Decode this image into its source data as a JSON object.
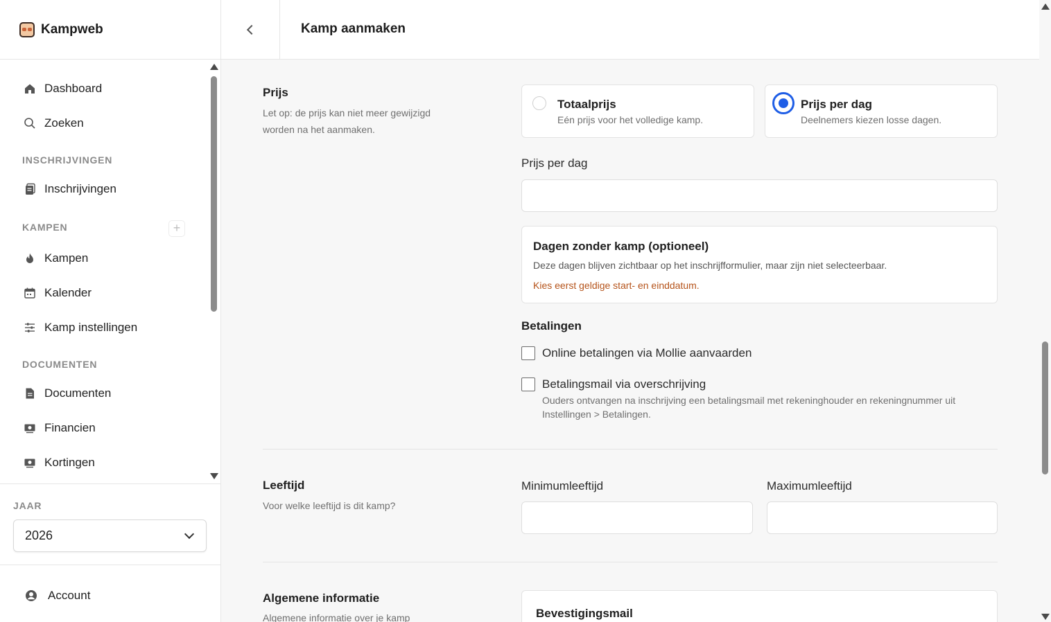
{
  "app": {
    "name": "Kampweb"
  },
  "header": {
    "title": "Kamp aanmaken"
  },
  "sidebar": {
    "items": [
      {
        "label": "Dashboard",
        "icon": "home-icon"
      },
      {
        "label": "Zoeken",
        "icon": "search-icon"
      },
      {
        "label": "Inschrijvingen",
        "icon": "clipboard-icon"
      },
      {
        "label": "Kampen",
        "icon": "fire-icon"
      },
      {
        "label": "Kalender",
        "icon": "calendar-icon"
      },
      {
        "label": "Kamp instellingen",
        "icon": "sliders-icon"
      },
      {
        "label": "Documenten",
        "icon": "document-icon"
      },
      {
        "label": "Financien",
        "icon": "money-icon"
      },
      {
        "label": "Kortingen",
        "icon": "discount-icon"
      }
    ],
    "sections": {
      "inschrijvingen": "INSCHRIJVINGEN",
      "kampen": "KAMPEN",
      "documenten": "DOCUMENTEN"
    },
    "add_symbol": "+",
    "year": {
      "label": "JAAR",
      "value": "2026"
    },
    "account": {
      "label": "Account"
    }
  },
  "prijs": {
    "title": "Prijs",
    "description": "Let op: de prijs kan niet meer gewijzigd worden na het aanmaken.",
    "options": [
      {
        "title": "Totaalprijs",
        "sub": "Eén prijs voor het volledige kamp.",
        "selected": false
      },
      {
        "title": "Prijs per dag",
        "sub": "Deelnemers kiezen losse dagen.",
        "selected": true
      }
    ],
    "field_label": "Prijs per dag",
    "field_value": ""
  },
  "dagen": {
    "title": "Dagen zonder kamp (optioneel)",
    "text": "Deze dagen blijven zichtbaar op het inschrijfformulier, maar zijn niet selecteerbaar.",
    "warning": "Kies eerst geldige start- en einddatum."
  },
  "betalingen": {
    "title": "Betalingen",
    "online_label": "Online betalingen via Mollie aanvaarden",
    "online_checked": false,
    "mail_label": "Betalingsmail via overschrijving",
    "mail_checked": false,
    "mail_help": "Ouders ontvangen na inschrijving een betalingsmail met rekeninghouder en rekeningnummer uit Instellingen > Betalingen."
  },
  "leeftijd": {
    "title": "Leeftijd",
    "description": "Voor welke leeftijd is dit kamp?",
    "min_label": "Minimumleeftijd",
    "min_value": "",
    "max_label": "Maximumleeftijd",
    "max_value": ""
  },
  "algemeen": {
    "title": "Algemene informatie",
    "description": "Algemene informatie over je kamp",
    "mail_card_title": "Bevestigingsmail"
  },
  "colors": {
    "accent": "#1f5ee6",
    "warning": "#b5531a"
  }
}
